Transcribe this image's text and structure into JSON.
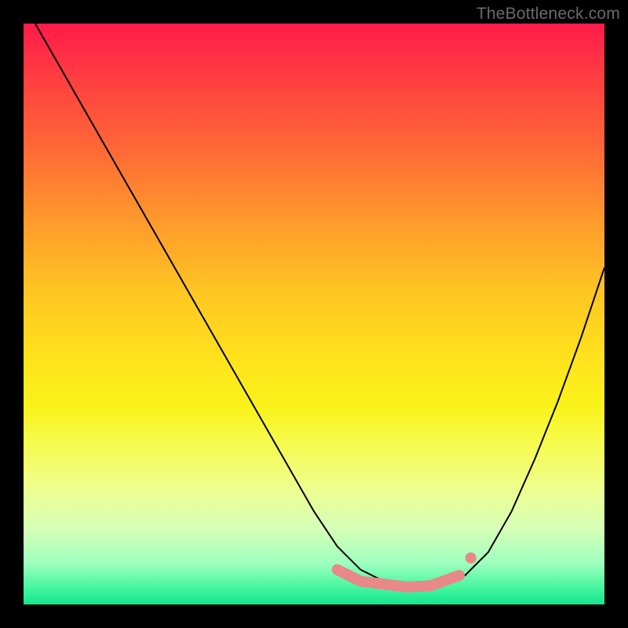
{
  "watermark": "TheBottleneck.com",
  "colors": {
    "frame": "#000000",
    "curve": "#000000",
    "marker_fill": "#e98888",
    "marker_stroke": "#d97070"
  },
  "chart_data": {
    "type": "line",
    "title": "",
    "xlabel": "",
    "ylabel": "",
    "xlim": [
      0,
      100
    ],
    "ylim": [
      0,
      100
    ],
    "grid": false,
    "legend": false,
    "series": [
      {
        "name": "bottleneck-curve",
        "x": [
          2,
          6,
          10,
          14,
          18,
          22,
          26,
          30,
          34,
          38,
          42,
          46,
          50,
          52,
          54,
          56,
          58,
          60,
          62,
          64,
          66,
          68,
          72,
          76,
          80,
          84,
          88,
          92,
          96,
          100
        ],
        "y": [
          100,
          93,
          86,
          79,
          72,
          65,
          58,
          51,
          44,
          37,
          30,
          23,
          16,
          13,
          10,
          8,
          6,
          5,
          4,
          3.5,
          3,
          3,
          3.5,
          5,
          9,
          16,
          25,
          35,
          46,
          58
        ]
      }
    ],
    "markers": [
      {
        "name": "optimum-band-left",
        "x": 54,
        "y": 6
      },
      {
        "name": "optimum-band-mid1",
        "x": 58,
        "y": 4
      },
      {
        "name": "optimum-band-mid2",
        "x": 62,
        "y": 3.5
      },
      {
        "name": "optimum-band-mid3",
        "x": 66,
        "y": 3
      },
      {
        "name": "optimum-band-right",
        "x": 70,
        "y": 3.2
      },
      {
        "name": "right-knee",
        "x": 75,
        "y": 5
      }
    ],
    "annotations": []
  }
}
